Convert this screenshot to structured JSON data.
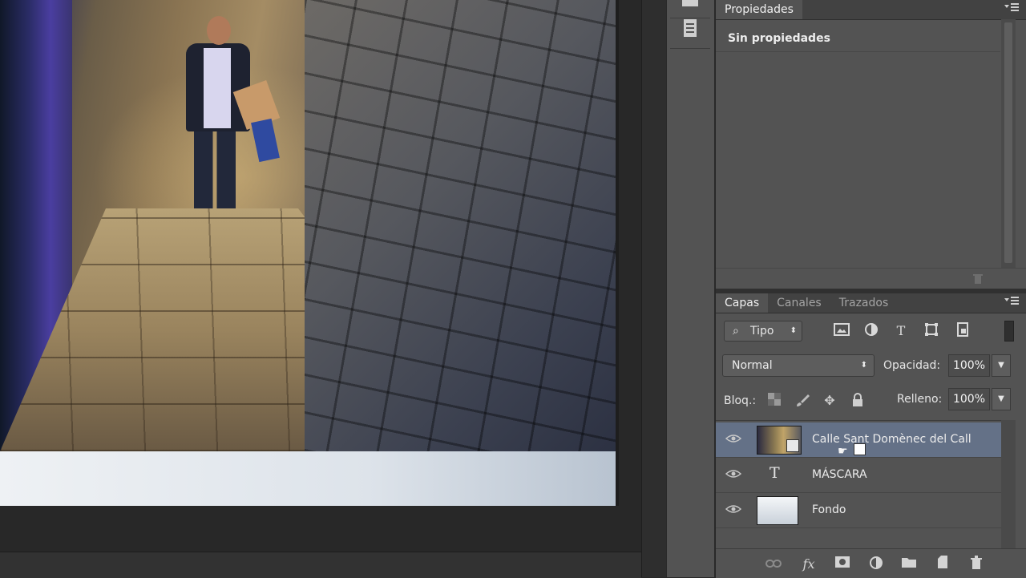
{
  "properties_panel": {
    "tab_label": "Propiedades",
    "empty_message": "Sin propiedades"
  },
  "layers_panel": {
    "tabs": [
      {
        "label": "Capas",
        "active": true
      },
      {
        "label": "Canales",
        "active": false
      },
      {
        "label": "Trazados",
        "active": false
      }
    ],
    "filter": {
      "label": "Tipo",
      "icon": "search-icon"
    },
    "filter_icons": [
      "image-filter-icon",
      "adjustment-filter-icon",
      "type-filter-icon",
      "shape-filter-icon",
      "smart-object-filter-icon"
    ],
    "blend_mode": "Normal",
    "opacity_label": "Opacidad:",
    "opacity_value": "100%",
    "lock_label": "Bloq.:",
    "lock_icons": [
      "lock-transparent-icon",
      "lock-paint-icon",
      "lock-move-icon",
      "lock-all-icon"
    ],
    "fill_label": "Relleno:",
    "fill_value": "100%",
    "layers": [
      {
        "name": "Calle Sant Domènec del Call",
        "kind": "smart-object",
        "visible": true,
        "selected": true
      },
      {
        "name": "MÁSCARA",
        "kind": "text",
        "visible": true,
        "selected": false,
        "type_glyph": "T"
      },
      {
        "name": "Fondo",
        "kind": "background",
        "visible": true,
        "selected": false
      }
    ],
    "footer_icons": [
      "link-layers-icon",
      "fx-icon",
      "add-mask-icon",
      "new-adjustment-icon",
      "new-group-icon",
      "new-layer-icon",
      "delete-layer-icon"
    ],
    "fx_label": "fx"
  },
  "colors": {
    "panel_bg": "#535353",
    "selected_layer": "#647187",
    "canvas_bg": "#282828"
  }
}
